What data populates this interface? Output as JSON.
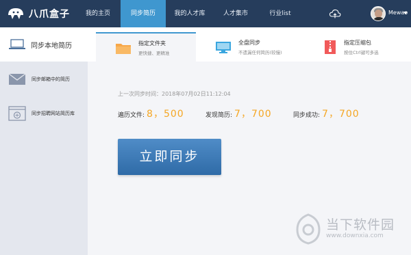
{
  "header": {
    "logo_text": "八爪盒子",
    "nav": [
      {
        "label": "我的主页"
      },
      {
        "label": "同步简历"
      },
      {
        "label": "我的人才库"
      },
      {
        "label": "人才集市"
      },
      {
        "label": "行业list"
      }
    ],
    "active_index": 1,
    "username": "Mewao",
    "icons": [
      "cloud-icon",
      "avatar",
      "caret-down-icon"
    ]
  },
  "sidebar": {
    "header_label": "同步本地简历",
    "items": [
      {
        "label": "同步邮箱中的简历",
        "icon": "envelope-icon"
      },
      {
        "label": "同步招聘网站简历库",
        "icon": "browser-icon"
      }
    ]
  },
  "cards": [
    {
      "title": "指定文件夹",
      "desc": "更快捷、更精准",
      "icon": "folder-icon",
      "color": "#f7a84a"
    },
    {
      "title": "全盘同步",
      "desc": "不遗漏任何简历(较慢)",
      "icon": "monitor-icon",
      "color": "#3aa6df"
    },
    {
      "title": "指定压缩包",
      "desc": "按住Ctrl键可多选",
      "icon": "zip-icon",
      "color": "#f15a5a"
    }
  ],
  "last_sync": "上一次同步时间：2018年07月02日11:12:04",
  "stats": [
    {
      "label": "遍历文件:",
      "value": "8，500"
    },
    {
      "label": "发现简历:",
      "value": "7，700"
    },
    {
      "label": "同步成功:",
      "value": "7，700"
    }
  ],
  "sync_button": "立即同步",
  "colors": {
    "topbar": "#263d5c",
    "active_nav": "#3f97cf",
    "accent": "#f5a623",
    "button": "#3a77b5"
  },
  "watermark": {
    "title": "当下软件园",
    "url": "www.downxia.com"
  }
}
